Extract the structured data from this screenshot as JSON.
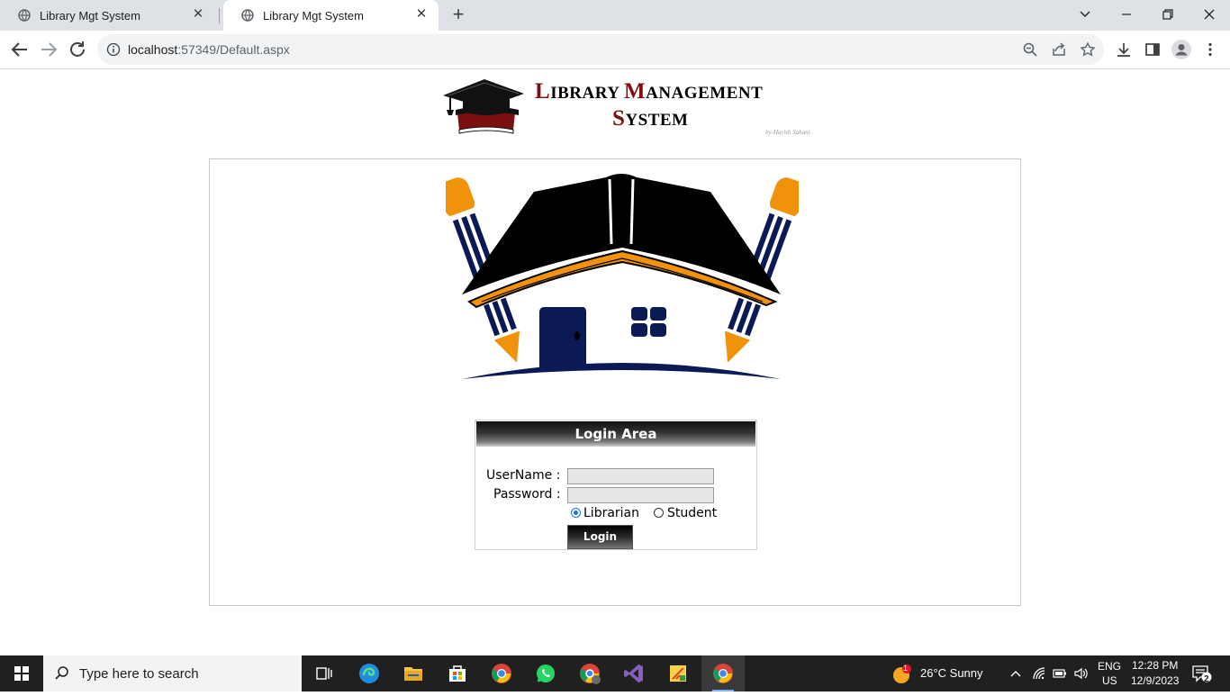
{
  "browser": {
    "tabs": [
      {
        "title": "Library Mgt System"
      },
      {
        "title": "Library Mgt System"
      }
    ],
    "url": "localhost:57349/Default.aspx",
    "url_host": "localhost",
    "url_rest": ":57349/Default.aspx"
  },
  "header": {
    "title_line1_L": "L",
    "title_line1_rest1": "IBRARY ",
    "title_line1_M": "M",
    "title_line1_rest2": "ANAGEMENT",
    "title_line2_S": "S",
    "title_line2_rest": "YSTEM",
    "byline": "by-Harish Sahani"
  },
  "login": {
    "header": "Login Area",
    "username_label": "UserName :",
    "password_label": "Password :",
    "username_value": "",
    "password_value": "",
    "role_options": [
      {
        "label": "Librarian",
        "selected": true
      },
      {
        "label": "Student",
        "selected": false
      }
    ],
    "button_label": "Login"
  },
  "taskbar": {
    "search_placeholder": "Type here to search",
    "weather": "26°C  Sunny",
    "weather_badge": "1",
    "language": "ENG",
    "region": "US",
    "time": "12:28 PM",
    "date": "12/9/2023",
    "notification_count": "2"
  },
  "colors": {
    "title_accent": "#7a1010",
    "house_roof": "#000000",
    "house_orange": "#f0920a",
    "house_navy": "#0b1a55",
    "radio_selected": "#1a73e8"
  }
}
